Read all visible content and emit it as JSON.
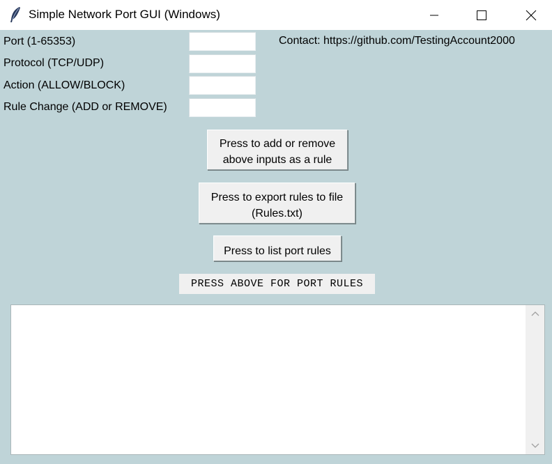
{
  "window": {
    "title": "Simple Network Port GUI (Windows)",
    "icons": {
      "app": "feather-icon",
      "minimize": "minimize-icon",
      "maximize": "maximize-icon",
      "close": "close-icon"
    }
  },
  "form": {
    "port_label": "Port (1-65353)",
    "protocol_label": "Protocol (TCP/UDP)",
    "action_label": "Action (ALLOW/BLOCK)",
    "rule_change_label": "Rule Change (ADD or REMOVE)",
    "port_value": "",
    "protocol_value": "",
    "action_value": "",
    "rule_change_value": ""
  },
  "contact": "Contact: https://github.com/TestingAccount2000",
  "buttons": {
    "rule_line1": "Press to add or remove",
    "rule_line2": "above inputs as a rule",
    "export_line1": "Press to export rules to file",
    "export_line2": "(Rules.txt)",
    "list": "Press to list port rules"
  },
  "status": "PRESS ABOVE FOR PORT RULES",
  "output": {
    "text": ""
  },
  "colors": {
    "background": "#bfd4d8",
    "button": "#f0f0f0",
    "titlebar": "#ffffff"
  }
}
